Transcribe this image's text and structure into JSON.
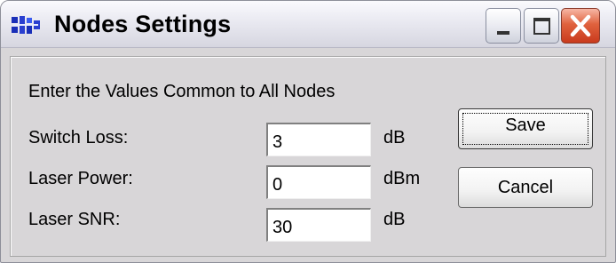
{
  "window": {
    "title": "Nodes Settings",
    "icon": "network-nodes-icon",
    "controls": {
      "minimize": "minimize-icon",
      "maximize": "maximize-icon",
      "close": "close-icon"
    }
  },
  "form": {
    "heading": "Enter the Values Common to All Nodes",
    "fields": [
      {
        "label": "Switch Loss:",
        "value": "3",
        "unit": "dB"
      },
      {
        "label": "Laser Power:",
        "value": "0",
        "unit": "dBm"
      },
      {
        "label": "Laser SNR:",
        "value": "30",
        "unit": "dB"
      }
    ]
  },
  "buttons": {
    "save": "Save",
    "cancel": "Cancel"
  },
  "colors": {
    "title_gradient_top": "#fafafd",
    "client_bg": "#d8d6d8",
    "close_button": "#e0623e"
  }
}
